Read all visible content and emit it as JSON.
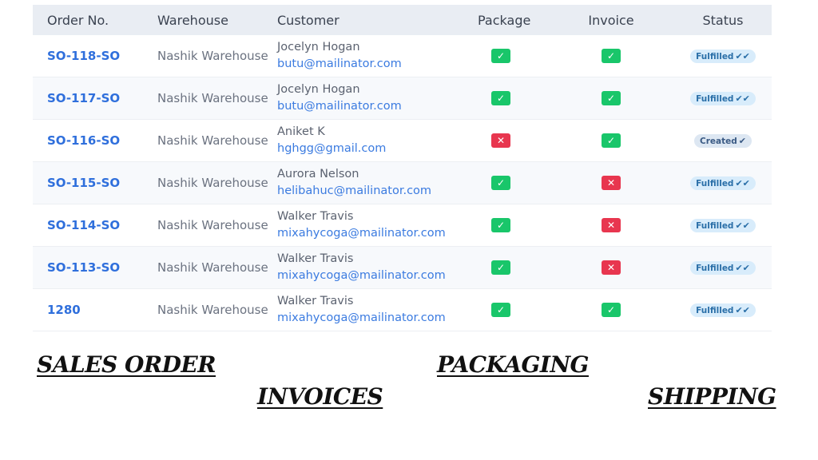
{
  "table": {
    "headers": {
      "order": "Order No.",
      "warehouse": "Warehouse",
      "customer": "Customer",
      "package": "Package",
      "invoice": "Invoice",
      "status": "Status"
    },
    "rows": [
      {
        "order": "SO-118-SO",
        "warehouse": "Nashik Warehouse",
        "name": "Jocelyn Hogan",
        "email": "butu@mailinator.com",
        "package": "✓",
        "invoice": "✓",
        "status": "Fulfilled"
      },
      {
        "order": "SO-117-SO",
        "warehouse": "Nashik Warehouse",
        "name": "Jocelyn Hogan",
        "email": "butu@mailinator.com",
        "package": "✓",
        "invoice": "✓",
        "status": "Fulfilled"
      },
      {
        "order": "SO-116-SO",
        "warehouse": "Nashik Warehouse",
        "name": "Aniket K",
        "email": "hghgg@gmail.com",
        "package": "✕",
        "invoice": "✓",
        "status": "Created"
      },
      {
        "order": "SO-115-SO",
        "warehouse": "Nashik Warehouse",
        "name": "Aurora Nelson",
        "email": "helibahuc@mailinator.com",
        "package": "✓",
        "invoice": "✕",
        "status": "Fulfilled"
      },
      {
        "order": "SO-114-SO",
        "warehouse": "Nashik Warehouse",
        "name": "Walker Travis",
        "email": "mixahycoga@mailinator.com",
        "package": "✓",
        "invoice": "✕",
        "status": "Fulfilled"
      },
      {
        "order": "SO-113-SO",
        "warehouse": "Nashik Warehouse",
        "name": "Walker Travis",
        "email": "mixahycoga@mailinator.com",
        "package": "✓",
        "invoice": "✕",
        "status": "Fulfilled"
      },
      {
        "order": "1280",
        "warehouse": "Nashik Warehouse",
        "name": "Walker Travis",
        "email": "mixahycoga@mailinator.com",
        "package": "✓",
        "invoice": "✓",
        "status": "Fulfilled"
      }
    ]
  },
  "labels": {
    "sales_order": "SALES ORDER",
    "packaging": "PACKAGING",
    "invoices": "INVOICES",
    "shipping": "SHIPPING"
  },
  "icons": {
    "check": "check-icon",
    "cross": "cross-icon",
    "fulfilled": "double-check-icon",
    "created": "check-icon"
  },
  "colors": {
    "order_link": "#2f6fdc",
    "email_link": "#3b7be0",
    "ok": "#19c66a",
    "no": "#e8364f",
    "fulfilled_bg": "#d8ecfb",
    "created_bg": "#dde7f2"
  }
}
